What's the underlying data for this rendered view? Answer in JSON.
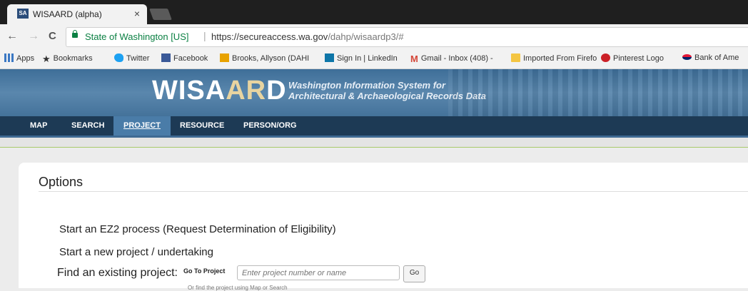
{
  "browser": {
    "tab": {
      "favicon": "SA",
      "title": "WISAARD (alpha)",
      "close": "×"
    },
    "nav": {
      "back": "←",
      "forward": "→",
      "reload": "C"
    },
    "address": {
      "secure_label": "State of Washington [US]",
      "separator": "|",
      "host": "https://secureaccess.wa.gov",
      "path": "/dahp/wisaardp3/#"
    },
    "bookmarks": [
      {
        "label": "Apps",
        "icon": "apps-grid-icon"
      },
      {
        "label": "Bookmarks",
        "icon": "star-icon"
      },
      {
        "label": "Twitter",
        "icon": "twitter-bird-icon"
      },
      {
        "label": "Facebook",
        "icon": "facebook-icon"
      },
      {
        "label": "Brooks, Allyson (DAHI",
        "icon": "outlook-icon"
      },
      {
        "label": "Sign In | LinkedIn",
        "icon": "linkedin-icon"
      },
      {
        "label": "Gmail - Inbox (408) -",
        "icon": "gmail-icon"
      },
      {
        "label": "Imported From Firefo",
        "icon": "folder-icon"
      },
      {
        "label": "Pinterest Logo",
        "icon": "pinterest-icon"
      },
      {
        "label": "Bank of Ame",
        "icon": "bank-of-america-icon"
      }
    ]
  },
  "header": {
    "logo_prefix": "WISA",
    "logo_accent": "AR",
    "logo_suffix": "D",
    "tagline_line1": "Washington Information System for",
    "tagline_line2": "Architectural & Archaeological Records Data"
  },
  "nav": {
    "items": [
      "MAP",
      "SEARCH",
      "PROJECT",
      "RESOURCE",
      "PERSON/ORG"
    ],
    "active": "PROJECT"
  },
  "options": {
    "title": "Options",
    "ez2_link": "Start an EZ2 process (Request Determination of Eligibility)",
    "new_project_link": "Start a new project / undertaking",
    "find_label": "Find an existing project:",
    "goto_label": "Go To Project",
    "goto_placeholder": "Enter project number or name",
    "go_button": "Go",
    "hint": "Or find the project using Map or Search"
  },
  "colors": {
    "banner": "#4f7ea6",
    "navbar": "#1d3a55",
    "nav_active": "#4a7ca8",
    "secure": "#0b8043"
  }
}
